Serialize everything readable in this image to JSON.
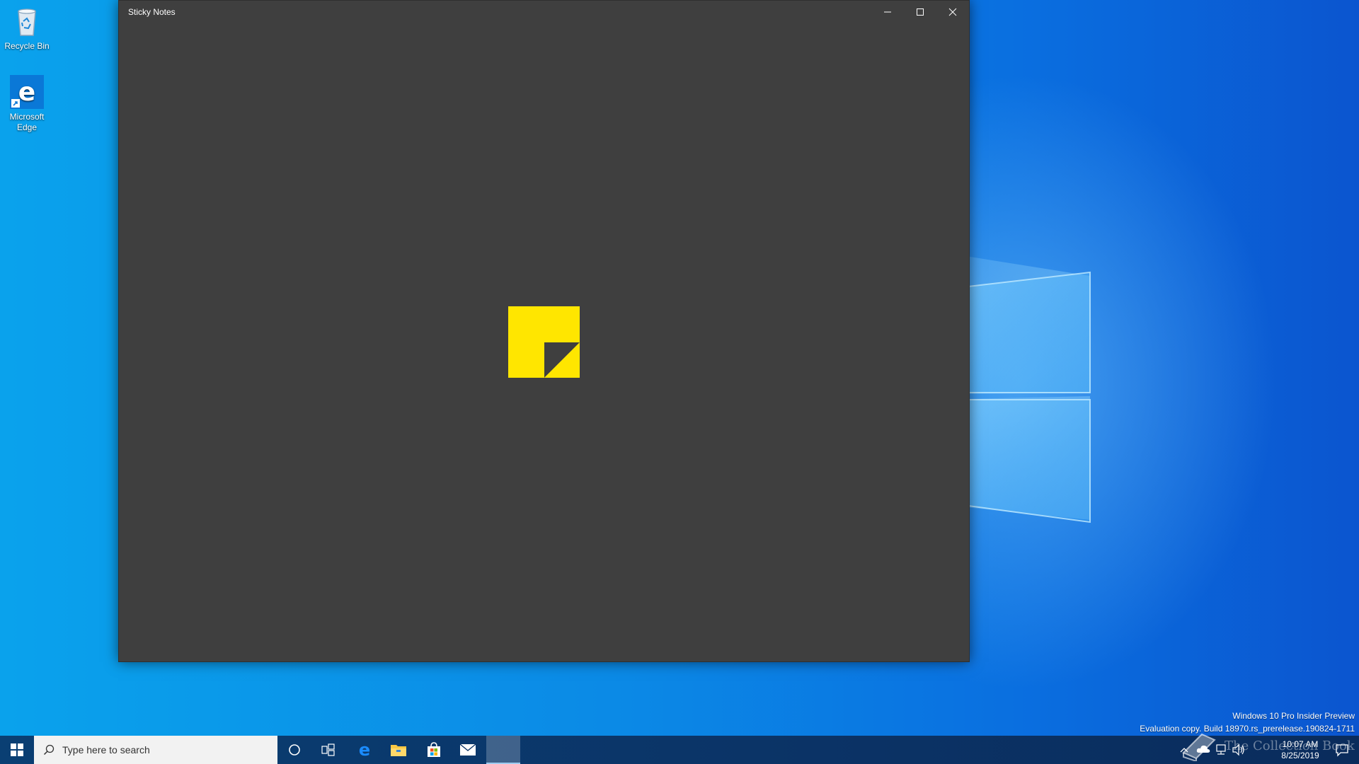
{
  "desktop": {
    "icons": [
      {
        "label": "Recycle Bin",
        "icon": "recycle-bin-icon"
      },
      {
        "label": "Microsoft Edge",
        "icon": "edge-icon"
      }
    ],
    "watermark": {
      "line1": "Windows 10 Pro Insider Preview",
      "line2": "Evaluation copy. Build 18970.rs_prerelease.190824-1711"
    },
    "overlay_brand": "The Collection Book",
    "colors": {
      "wallpaper": "#0b8ae6",
      "sticky_yellow": "#ffe600",
      "app_background": "#3f3f3f"
    }
  },
  "window": {
    "title": "Sticky Notes",
    "buttons": {
      "minimize": "minimize-icon",
      "maximize": "maximize-icon",
      "close": "close-icon"
    }
  },
  "taskbar": {
    "search_placeholder": "Type here to search",
    "pinned": [
      "cortana-icon",
      "task-view-icon",
      "edge-icon",
      "file-explorer-icon",
      "store-icon",
      "mail-icon",
      "sticky-notes-icon"
    ],
    "clock": {
      "time": "10:07 AM",
      "date": "8/25/2019"
    }
  }
}
